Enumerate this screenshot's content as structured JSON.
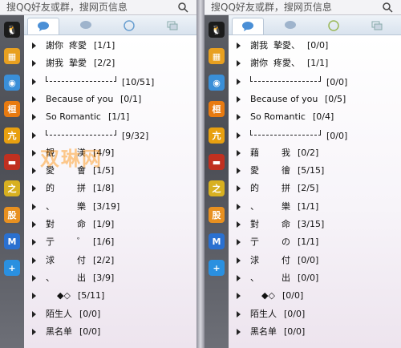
{
  "search_placeholder": "搜QQ好友或群，搜网页信息",
  "colors": {
    "sidebar": "#4a4c53",
    "tab_bg": "#d9e3ee",
    "watermark": "#ff8c00"
  },
  "sidebar_icons": [
    "qq-penguin-icon",
    "qzone-icon",
    "chat-bubble-icon",
    "hui-icon",
    "chong-icon",
    "car-icon",
    "earth-icon",
    "fu-icon",
    "m-icon",
    "plus-icon"
  ],
  "tabs": [
    "contacts-tab",
    "groups-tab",
    "qzone-tab",
    "recent-tab"
  ],
  "watermark": "双琳网",
  "left": {
    "groups": [
      {
        "name": "謝你  疼愛",
        "count": "[1/1]"
      },
      {
        "name": "謝我  摯愛",
        "count": "[2/2]"
      },
      {
        "name": "",
        "count": "[10/51]",
        "bracket": true
      },
      {
        "name": "Because of you",
        "count": "[0/1]"
      },
      {
        "name": "So Romantic",
        "count": "[1/1]"
      },
      {
        "name": "",
        "count": "[9/32]",
        "bracket": true
      },
      {
        "name": "覩        渼",
        "count": "[4/9]"
      },
      {
        "name": "愛        會",
        "count": "[1/5]"
      },
      {
        "name": "的        拼",
        "count": "[1/8]"
      },
      {
        "name": "、        樂",
        "count": "[3/19]"
      },
      {
        "name": "對        命",
        "count": "[1/9]"
      },
      {
        "name": "亍        ゜",
        "count": "[1/6]"
      },
      {
        "name": "浗        付",
        "count": "[2/2]"
      },
      {
        "name": "、        出",
        "count": "[3/9]"
      },
      {
        "name": "    ◆◇",
        "count": "[5/11]"
      },
      {
        "name": "陌生人",
        "count": "[0/0]"
      },
      {
        "name": "黑名单",
        "count": "[0/0]"
      }
    ]
  },
  "right": {
    "groups": [
      {
        "name": "謝我  摯愛、",
        "count": "[0/0]"
      },
      {
        "name": "謝你  疼愛、",
        "count": "[1/1]"
      },
      {
        "name": "",
        "count": "[0/0]",
        "bracket": true
      },
      {
        "name": "Because of you",
        "count": "[0/5]"
      },
      {
        "name": "So Romantic",
        "count": "[0/4]"
      },
      {
        "name": "",
        "count": "[0/0]",
        "bracket": true
      },
      {
        "name": "藉        我",
        "count": "[0/2]"
      },
      {
        "name": "愛        徻",
        "count": "[5/15]"
      },
      {
        "name": "的        拼",
        "count": "[2/5]"
      },
      {
        "name": "、        樂",
        "count": "[1/1]"
      },
      {
        "name": "對        命",
        "count": "[3/15]"
      },
      {
        "name": "亍        の",
        "count": "[1/1]"
      },
      {
        "name": "浗        付",
        "count": "[0/0]"
      },
      {
        "name": "、        出",
        "count": "[0/0]"
      },
      {
        "name": "    ◆◇",
        "count": "[0/0]"
      },
      {
        "name": "陌生人",
        "count": "[0/0]"
      },
      {
        "name": "黑名单",
        "count": "[0/0]"
      }
    ]
  }
}
